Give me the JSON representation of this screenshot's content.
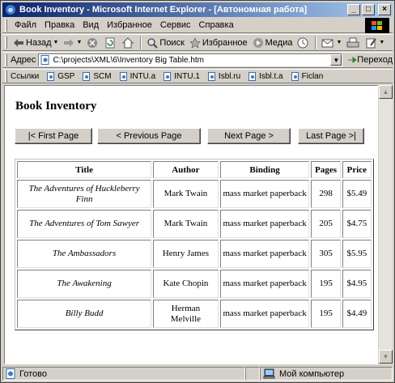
{
  "window": {
    "title": "Book Inventory - Microsoft Internet Explorer - [Автономная работа]"
  },
  "menu": [
    "Файл",
    "Правка",
    "Вид",
    "Избранное",
    "Сервис",
    "Справка"
  ],
  "toolbar": {
    "back": "Назад",
    "search": "Поиск",
    "favorites": "Избранное",
    "media": "Медиа"
  },
  "address": {
    "label": "Адрес",
    "value": "C:\\projects\\XML\\6\\Inventory Big Table.htm",
    "go": "Переход"
  },
  "links": {
    "label": "Ссылки",
    "items": [
      "GSP",
      "SCM",
      "INTU.a",
      "INTU.1",
      "Isbl.ru",
      "Isbl.t.a",
      "Ficlan"
    ]
  },
  "page": {
    "heading": "Book Inventory",
    "buttons": {
      "first": "|< First Page",
      "previous": "< Previous Page",
      "next": "Next Page >",
      "last": "Last Page >|"
    }
  },
  "table": {
    "headers": [
      "Title",
      "Author",
      "Binding",
      "Pages",
      "Price"
    ],
    "rows": [
      [
        "The Adventures of Huckleberry Finn",
        "Mark Twain",
        "mass market paperback",
        "298",
        "$5.49"
      ],
      [
        "The Adventures of Tom Sawyer",
        "Mark Twain",
        "mass market paperback",
        "205",
        "$4.75"
      ],
      [
        "The Ambassadors",
        "Henry James",
        "mass market paperback",
        "305",
        "$5.95"
      ],
      [
        "The Awakening",
        "Kate Chopin",
        "mass market paperback",
        "195",
        "$4.95"
      ],
      [
        "Billy Budd",
        "Herman Melville",
        "mass market paperback",
        "195",
        "$4.49"
      ]
    ]
  },
  "status": {
    "left": "Готово",
    "zone": "Мой компьютер"
  }
}
